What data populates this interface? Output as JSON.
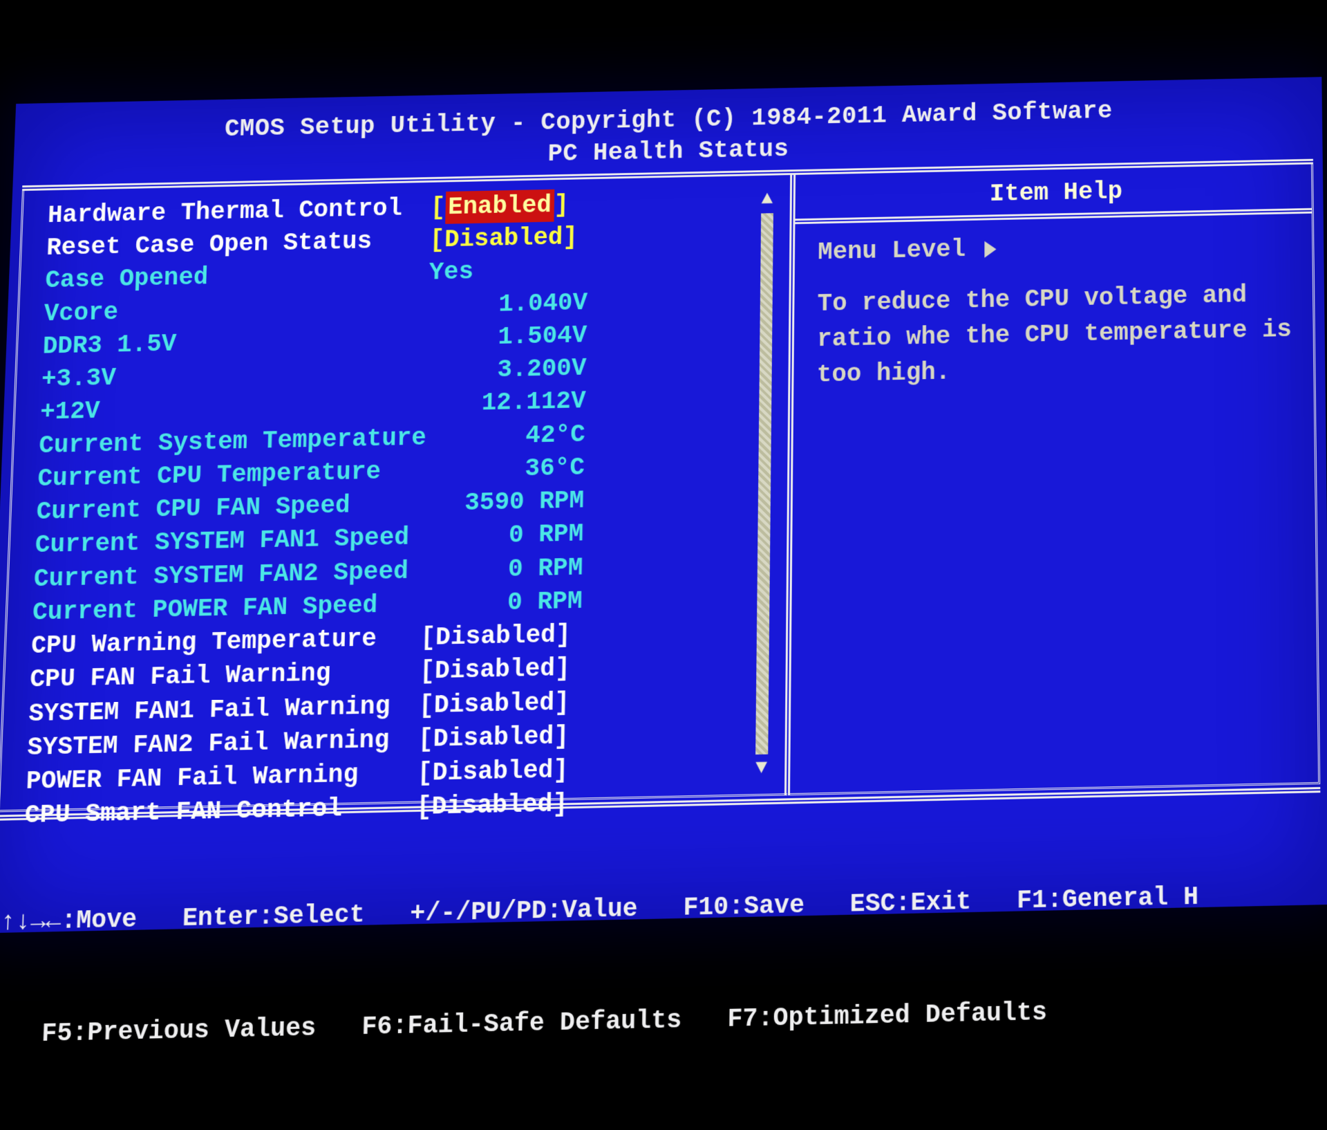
{
  "header": {
    "title": "CMOS Setup Utility - Copyright (C) 1984-2011 Award Software",
    "subtitle": "PC Health Status"
  },
  "rows": {
    "hw_thermal": {
      "label": "Hardware Thermal Control",
      "value": "Enabled",
      "editable": true,
      "selected": true,
      "bracketed": true
    },
    "reset_case": {
      "label": "Reset Case Open Status",
      "value": "Disabled",
      "editable": true,
      "bracketed": true,
      "yellow": true
    },
    "case_opened": {
      "label": "Case Opened",
      "value": "Yes",
      "editable": false
    },
    "vcore": {
      "label": "Vcore",
      "value": "1.040V",
      "editable": false,
      "numeric": true
    },
    "ddr3": {
      "label": "DDR3 1.5V",
      "value": "1.504V",
      "editable": false,
      "numeric": true
    },
    "v33": {
      "label": "+3.3V",
      "value": "3.200V",
      "editable": false,
      "numeric": true
    },
    "v12": {
      "label": "+12V",
      "value": "12.112V",
      "editable": false,
      "numeric": true
    },
    "sys_temp": {
      "label": "Current System Temperature",
      "value": "42°C",
      "editable": false,
      "numeric": true
    },
    "cpu_temp": {
      "label": "Current CPU Temperature",
      "value": "36°C",
      "editable": false,
      "numeric": true
    },
    "cpu_fan": {
      "label": "Current CPU FAN Speed",
      "value": "3590 RPM",
      "editable": false,
      "numeric": true
    },
    "sys_fan1": {
      "label": "Current SYSTEM FAN1 Speed",
      "value": "0 RPM",
      "editable": false,
      "numeric": true
    },
    "sys_fan2": {
      "label": "Current SYSTEM FAN2 Speed",
      "value": "0 RPM",
      "editable": false,
      "numeric": true
    },
    "pwr_fan": {
      "label": "Current POWER FAN Speed",
      "value": "0 RPM",
      "editable": false,
      "numeric": true
    },
    "cpu_warn_temp": {
      "label": "CPU Warning Temperature",
      "value": "Disabled",
      "editable": true,
      "bracketed": true
    },
    "cpu_fan_fail": {
      "label": "CPU FAN Fail Warning",
      "value": "Disabled",
      "editable": true,
      "bracketed": true
    },
    "sys_fan1_fail": {
      "label": "SYSTEM FAN1 Fail Warning",
      "value": "Disabled",
      "editable": true,
      "bracketed": true
    },
    "sys_fan2_fail": {
      "label": "SYSTEM FAN2 Fail Warning",
      "value": "Disabled",
      "editable": true,
      "bracketed": true
    },
    "pwr_fan_fail": {
      "label": "POWER FAN Fail Warning",
      "value": "Disabled",
      "editable": true,
      "bracketed": true
    },
    "smart_fan": {
      "label": "CPU Smart FAN Control",
      "value": "Disabled",
      "editable": true,
      "bracketed": true
    }
  },
  "right": {
    "title": "Item Help",
    "menu_level_label": "Menu Level",
    "help_text": "To reduce the CPU voltage and ratio whe the CPU temperature is too high."
  },
  "footer": {
    "line1": "↑↓→←:Move   Enter:Select   +/-/PU/PD:Value   F10:Save   ESC:Exit   F1:General H",
    "line2": "   F5:Previous Values   F6:Fail-Safe Defaults   F7:Optimized Defaults"
  }
}
